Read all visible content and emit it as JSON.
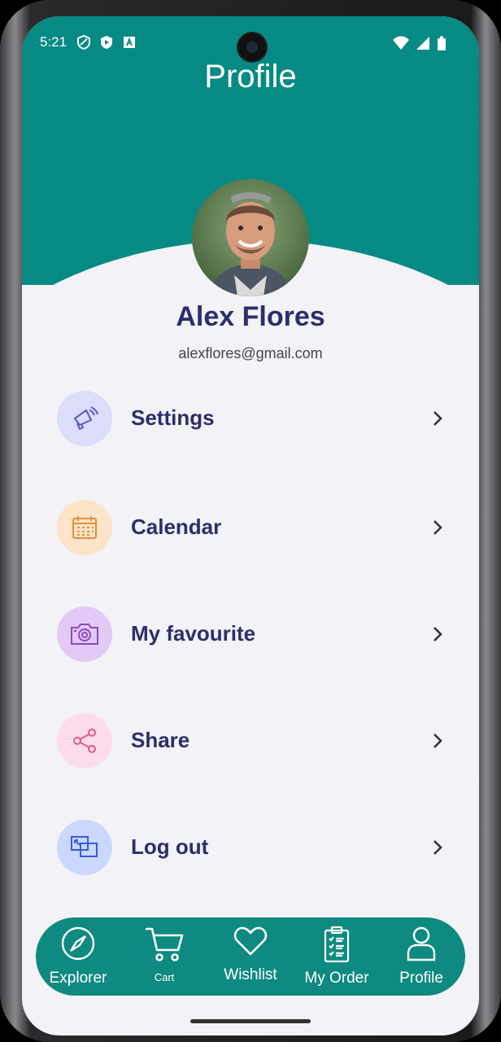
{
  "status": {
    "time": "5:21"
  },
  "header": {
    "title": "Profile"
  },
  "user": {
    "name": "Alex Flores",
    "email": "alexflores@gmail.com"
  },
  "menu": [
    {
      "label": "Settings",
      "icon": "megaphone-icon",
      "bg": "#dcdcfb"
    },
    {
      "label": "Calendar",
      "icon": "calendar-icon",
      "bg": "#fde3c7"
    },
    {
      "label": "My favourite",
      "icon": "camera-icon",
      "bg": "#e3c9f5"
    },
    {
      "label": "Share",
      "icon": "share-icon",
      "bg": "#fcdcec"
    },
    {
      "label": "Log out",
      "icon": "logout-icon",
      "bg": "#c9d8fc"
    }
  ],
  "nav": [
    {
      "label": "Explorer",
      "icon": "compass-icon"
    },
    {
      "label": "Cart",
      "icon": "cart-icon"
    },
    {
      "label": "Wishlist",
      "icon": "heart-icon"
    },
    {
      "label": "My Order",
      "icon": "clipboard-icon"
    },
    {
      "label": "Profile",
      "icon": "person-icon"
    }
  ],
  "colors": {
    "primary": "#068a84",
    "nav": "#0f8a80",
    "text_dark": "#2f2d6b",
    "background": "#f2f2f7"
  }
}
